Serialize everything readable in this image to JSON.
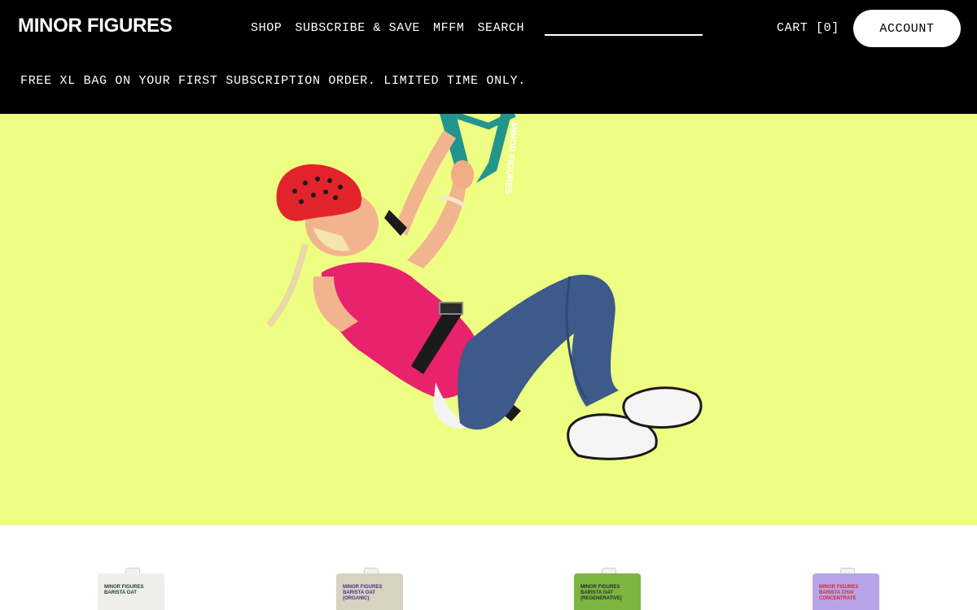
{
  "header": {
    "logo": "MINOR FIGURES",
    "nav": [
      "SHOP",
      "SUBSCRIBE & SAVE",
      "MFFM",
      "SEARCH"
    ],
    "search_value": "",
    "cart": "CART [0]",
    "account": "ACCOUNT"
  },
  "promo": "FREE XL BAG ON YOUR FIRST SUBSCRIPTION ORDER. LIMITED TIME ONLY.",
  "hero": {
    "background": "#eefe82",
    "strap_text": "MINOR FIGURES"
  },
  "products": [
    {
      "brand": "MINOR FIGURES",
      "variant": "BARISTA OAT",
      "color": "#eeeeea",
      "text_color": "#1d3c2a"
    },
    {
      "brand": "MINOR FIGURES",
      "variant": "BARISTA OAT\n(ORGANIC)",
      "color": "#d8d2c0",
      "text_color": "#4a2c8a"
    },
    {
      "brand": "MINOR FIGURES",
      "variant": "BARISTA OAT\n(REGENERATIVE)",
      "color": "#7bb642",
      "text_color": "#2b2b2b"
    },
    {
      "brand": "MINOR FIGURES",
      "variant": "BARISTA CHAI\nCONCENTRATE",
      "color": "#b9a3e8",
      "text_color": "#d6262e"
    }
  ]
}
